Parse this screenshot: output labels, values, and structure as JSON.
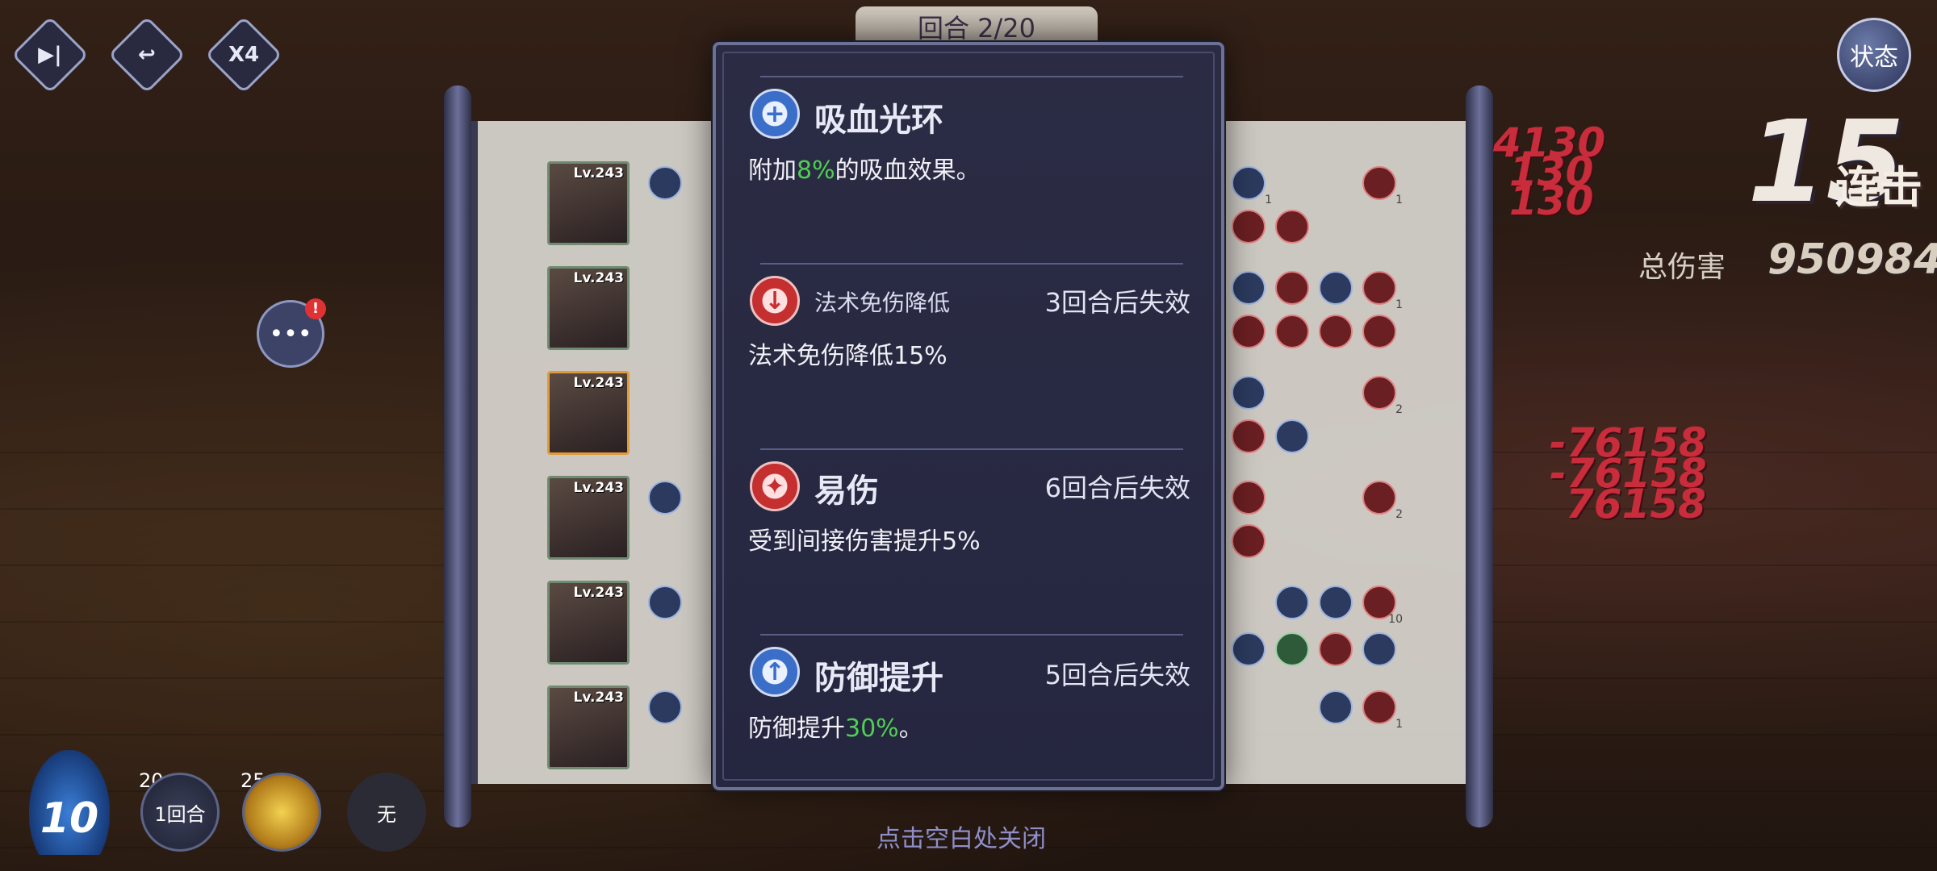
{
  "hud": {
    "skip_icon": "skip-icon",
    "undo_icon": "undo-icon",
    "speed_label": "X4",
    "round_text": "回合 2/20",
    "status_label": "状态",
    "combo_count": "15",
    "combo_label": "连击",
    "total_damage_label": "总伤害",
    "total_damage_value": "950984",
    "damage_numbers_top": [
      "4130",
      "130",
      "130"
    ],
    "damage_numbers_right": [
      "-76158",
      "-76158",
      "76158"
    ],
    "chat_badge": "!"
  },
  "bottom": {
    "energy": "10",
    "skills": [
      {
        "cost": "20",
        "label": "1回合"
      },
      {
        "cost": "25",
        "label": ""
      },
      {
        "cost": "",
        "label": "无"
      }
    ],
    "close_hint": "点击空白处关闭"
  },
  "roster": [
    {
      "level": "Lv.243",
      "buff_counts": [
        "1",
        "1",
        "1"
      ]
    },
    {
      "level": "Lv.243",
      "buff_counts": [
        "1",
        "1",
        "1"
      ]
    },
    {
      "level": "Lv.243",
      "buff_counts": [
        "1",
        "1",
        "2"
      ]
    },
    {
      "level": "Lv.243",
      "buff_counts": [
        "1",
        "1",
        "2"
      ]
    },
    {
      "level": "Lv.243",
      "buff_counts": [
        "1",
        "1",
        "10"
      ]
    },
    {
      "level": "Lv.243",
      "buff_counts": [
        "1",
        "1",
        "1"
      ]
    }
  ],
  "tooltip": {
    "entries": [
      {
        "icon": "droplet-plus-icon",
        "title": "吸血光环",
        "expire": "",
        "desc_prefix": "附加",
        "desc_value": "8%",
        "desc_suffix": "的吸血效果。"
      },
      {
        "icon": "magic-shield-down-icon",
        "title": "法术免伤降低",
        "expire": "3回合后失效",
        "desc_prefix": "法术免伤降低15%",
        "desc_value": "",
        "desc_suffix": ""
      },
      {
        "icon": "vulnerable-icon",
        "title": "易伤",
        "expire": "6回合后失效",
        "desc_prefix": "受到间接伤害提升5%",
        "desc_value": "",
        "desc_suffix": ""
      },
      {
        "icon": "defense-up-icon",
        "title": "防御提升",
        "expire": "5回合后失效",
        "desc_prefix": "防御提升",
        "desc_value": "30%",
        "desc_suffix": "。"
      }
    ]
  },
  "colors": {
    "highlight": "#4fcf52",
    "panel_bg": "#2b2c44",
    "damage": "#c92c3a"
  }
}
